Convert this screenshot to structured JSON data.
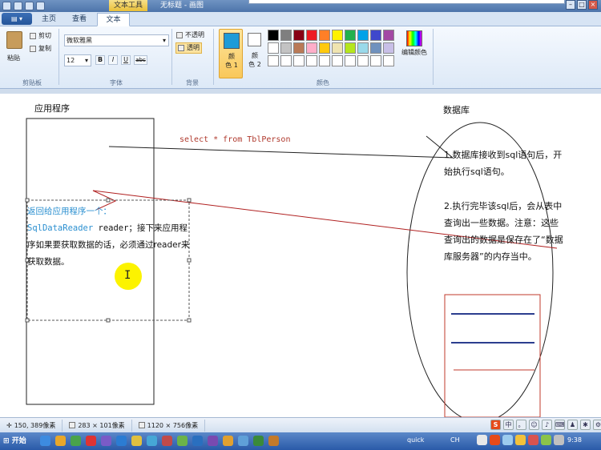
{
  "titlebar": {
    "context_label": "文本工具",
    "doc_title": "无标题 - 画图"
  },
  "tabs": {
    "home": "主页",
    "view": "查看",
    "text": "文本"
  },
  "clipboard": {
    "paste": "粘贴",
    "cut": "剪切",
    "copy": "复制",
    "group": "剪贴板"
  },
  "font": {
    "family": "微软雅黑",
    "size": "12",
    "bold": "B",
    "italic": "I",
    "underline": "U",
    "strike": "abc",
    "group": "字体"
  },
  "background": {
    "opaque": "不透明",
    "transparent": "透明",
    "group": "背景"
  },
  "colors": {
    "color1_line1": "颜",
    "color1_line2": "色 1",
    "color2_line1": "颜",
    "color2_line2": "色 2",
    "edit": "编辑颜色",
    "group": "颜色",
    "color1_value": "#1e9bd8",
    "color2_value": "#ffffff",
    "palette": [
      "#000000",
      "#7f7f7f",
      "#880015",
      "#ed1c24",
      "#ff7f27",
      "#fff200",
      "#22b14c",
      "#00a2e8",
      "#3f48cc",
      "#a349a4",
      "#ffffff",
      "#c3c3c3",
      "#b97a57",
      "#ffaec9",
      "#ffc90e",
      "#efe4b0",
      "#b5e61d",
      "#99d9ea",
      "#7092be",
      "#c8bfe7",
      "#ffffff",
      "#ffffff",
      "#ffffff",
      "#ffffff",
      "#ffffff",
      "#ffffff",
      "#ffffff",
      "#ffffff",
      "#ffffff",
      "#ffffff"
    ]
  },
  "canvas": {
    "app_label": "应用程序",
    "db_label": "数据库",
    "sql": "select * from TblPerson",
    "return_title": "返回给应用程序一个：",
    "reader_type": "SqlDataReader",
    "reader_var": " reader；",
    "return_rest1": "接下来应用程序如果要获取数据的话，必须通过",
    "return_reader": "reader",
    "return_rest2": "来获取数据。",
    "db_text1": "1.数据库接收到sql语句后，开始执行sql语句。",
    "db_text2": "2.执行完毕该sql后，会从表中查询出一些数据。注意：这些查询出的数据是保存在了“数据库服务器”的内存当中。"
  },
  "status": {
    "cursor_pos": "150, 389像素",
    "selection_size": "283 × 101像素",
    "image_size": "1120 × 756像素"
  },
  "taskbar": {
    "start": "开始",
    "quick": "quick",
    "lang": "CH",
    "clock": "9:38"
  }
}
